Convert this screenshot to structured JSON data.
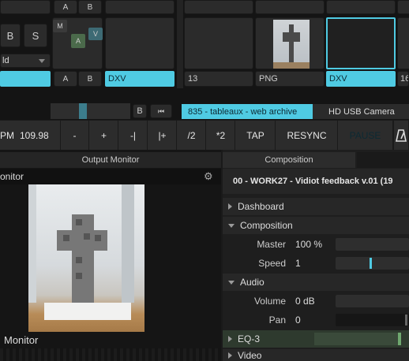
{
  "clip_grid": {
    "top_buttons": [
      "A",
      "B"
    ],
    "left_buttons": [
      "B",
      "S"
    ],
    "blend_value": "ld",
    "small_buttons": {
      "m": "M",
      "a": "A",
      "v": "V"
    },
    "ab_bottom": [
      "A",
      "B"
    ],
    "col_labels": [
      "DXV",
      "13",
      "PNG",
      "DXV",
      "16"
    ]
  },
  "transport": {
    "b_button": "B",
    "clip_name": "835 - tableaux - web archive",
    "camera": "HD USB Camera"
  },
  "tempo": {
    "bpm_label": "PM",
    "bpm_value": "109.98",
    "buttons": [
      "-",
      "+",
      "-|",
      "|+",
      "/2",
      "*2",
      "TAP",
      "RESYNC",
      "PAUSE"
    ],
    "metronome_icon": "metronome-icon"
  },
  "output_monitor": {
    "tab": "Output Monitor",
    "title": "onitor",
    "footer": "Monitor"
  },
  "composition_panel": {
    "tab": "Composition",
    "title": "00 - WORK27 - Vidiot feedback v.01 (19",
    "sections": {
      "dashboard": "Dashboard",
      "composition": "Composition",
      "audio": "Audio",
      "eq3": "EQ-3",
      "video": "Video"
    },
    "params": {
      "master_label": "Master",
      "master_value": "100 %",
      "speed_label": "Speed",
      "speed_value": "1",
      "volume_label": "Volume",
      "volume_value": "0 dB",
      "pan_label": "Pan",
      "pan_value": "0"
    },
    "accent": "#4fcbe3"
  }
}
